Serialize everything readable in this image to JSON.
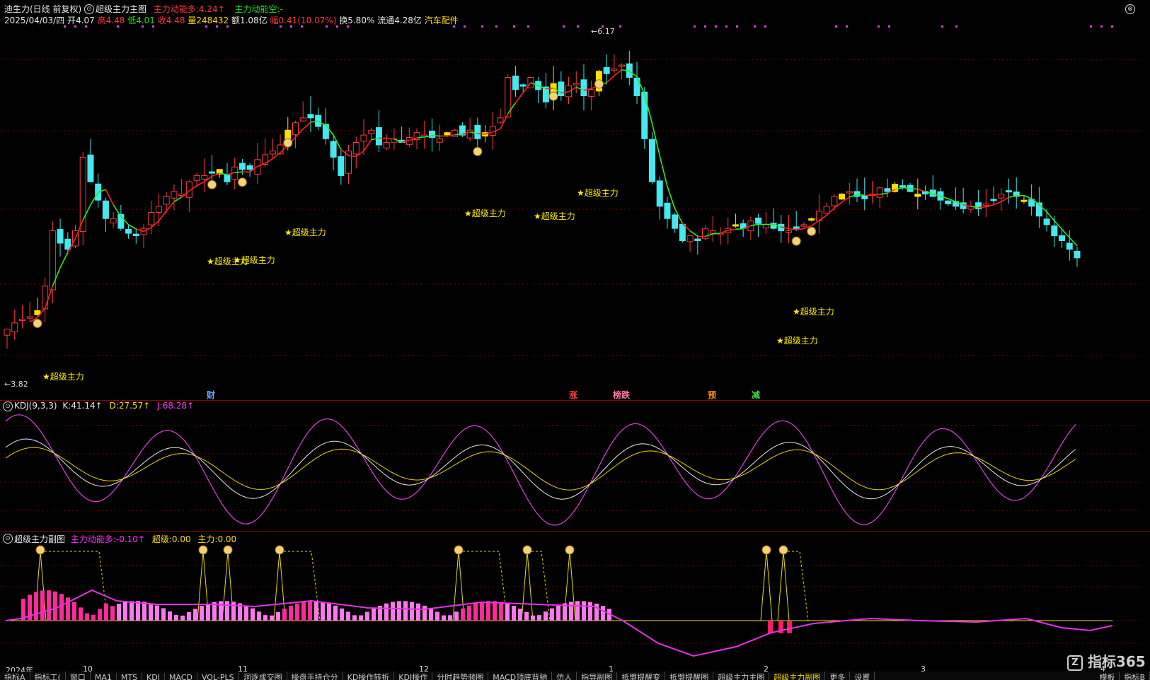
{
  "main": {
    "title": "迪生力(日线 前复权)",
    "indicator_name": "超级主力主图",
    "indicator_values": [
      {
        "label": "主力动能多:",
        "value": "4.24↑",
        "color": "#ff3b3b"
      },
      {
        "label": "主力动能空:",
        "value": "-",
        "color": "#22dd22"
      }
    ],
    "info": {
      "date": "2025/04/03/四",
      "open_label": "开",
      "open": "4.07",
      "high_label": "高",
      "high": "4.48",
      "low_label": "低",
      "low": "4.01",
      "close_label": "收",
      "close": "4.48",
      "vol_label": "量",
      "vol": "248432",
      "amt_label": "额",
      "amt": "1.08亿",
      "chg_label": "幅",
      "chg": "0.41(10.07%)",
      "turnover_label": "换",
      "turnover": "5.80%",
      "float_label": "流通",
      "float": "4.28亿",
      "sector": "汽车配件"
    },
    "max_price": "6.17",
    "min_price": "3.82",
    "tag_text": "★超级主力",
    "event_marks": [
      "财",
      "涨",
      "榜跌",
      "预",
      "减"
    ]
  },
  "kdj": {
    "name": "KDJ(9,3,3)",
    "k_label": "K:",
    "k": "41.14↑",
    "d_label": "D:",
    "d": "27.57↑",
    "j_label": "J:",
    "j": "68.28↑"
  },
  "sub": {
    "name": "超级主力副图",
    "a_label": "主力动能多:",
    "a": "-0.10↑",
    "b_label": "超级:",
    "b": "0.00",
    "c_label": "主力:",
    "c": "0.00"
  },
  "date_axis": [
    "2024年",
    "10",
    "11",
    "12",
    "1",
    "2",
    "3",
    "4"
  ],
  "bottom_tabs": [
    "指标A",
    "指标工(",
    "窗口",
    "MA1",
    "MTS",
    "KDJ",
    "MACD",
    "VOL-PLS",
    "洞逐成交图",
    "操盘手持仓分",
    "KD操作转折",
    "KDJ操作",
    "分时趋势频图",
    "MACD顶底背驰",
    "仿人",
    "指导副图",
    "抵盟提醒变",
    "抵盟提醒图",
    "超级主力主图",
    "超级主力副图",
    "更多",
    "设置"
  ],
  "active_tab": "超级主力副图",
  "bottom_right_tabs": [
    "指标B",
    "模板"
  ],
  "watermark": "指标365",
  "colors": {
    "up": "#ff3b3b",
    "down": "#44e8ee",
    "super": "#ffdd00",
    "ma_up": "#ff2020",
    "ma_down": "#22ee22",
    "k": "#e8e8e8",
    "d": "#e8d400",
    "j": "#e040e0",
    "sub_line": "#e830e8",
    "sub_bar": "#ff2a9a",
    "sub_bar_light": "#ff77ee"
  }
}
